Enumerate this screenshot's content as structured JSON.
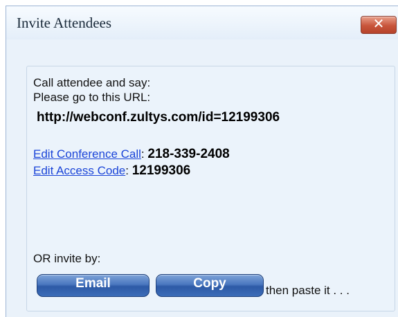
{
  "window": {
    "title": "Invite Attendees",
    "close_label": "✕"
  },
  "content": {
    "line1": "Call attendee and say:",
    "line2": "Please go to this URL:",
    "url": "http://webconf.zultys.com/id=12199306",
    "conference_call_link": "Edit Conference Call",
    "conference_call_sep": ":",
    "conference_call_number": "218-339-2408",
    "access_code_link": "Edit Access Code",
    "access_code_sep": ":",
    "access_code_value": "12199306",
    "or_invite": "OR invite by:",
    "email_button": "Email",
    "copy_button": "Copy",
    "paste_note": "then paste it . . ."
  }
}
